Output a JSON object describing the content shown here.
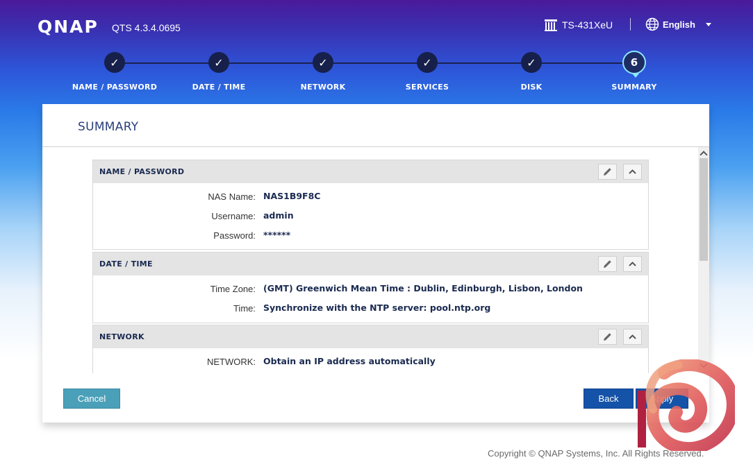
{
  "header": {
    "logo": "QNAP",
    "version": "QTS 4.3.4.0695",
    "model": "TS-431XeU",
    "language": "English"
  },
  "stepper": {
    "steps": [
      {
        "label": "NAME / PASSWORD",
        "state": "done"
      },
      {
        "label": "DATE / TIME",
        "state": "done"
      },
      {
        "label": "NETWORK",
        "state": "done"
      },
      {
        "label": "SERVICES",
        "state": "done"
      },
      {
        "label": "DISK",
        "state": "done"
      },
      {
        "label": "SUMMARY",
        "state": "current",
        "number": "6"
      }
    ],
    "check": "✓"
  },
  "card": {
    "title": "SUMMARY",
    "sections": [
      {
        "title": "NAME / PASSWORD",
        "rows": [
          {
            "key": "NAS Name:",
            "value": "NAS1B9F8C"
          },
          {
            "key": "Username:",
            "value": "admin"
          },
          {
            "key": "Password:",
            "value": "******"
          }
        ]
      },
      {
        "title": "DATE / TIME",
        "rows": [
          {
            "key": "Time Zone:",
            "value": "(GMT) Greenwich Mean Time : Dublin, Edinburgh, Lisbon, London"
          },
          {
            "key": "Time:",
            "value": "Synchronize with the NTP server: pool.ntp.org"
          }
        ]
      },
      {
        "title": "NETWORK",
        "rows": [
          {
            "key": "NETWORK:",
            "value": "Obtain an IP address automatically"
          }
        ]
      }
    ]
  },
  "buttons": {
    "cancel": "Cancel",
    "back": "Back",
    "apply": "Apply"
  },
  "footer": {
    "copyright": "Copyright © QNAP Systems, Inc. All Rights Reserved."
  },
  "colors": {
    "accent": "#1553a8",
    "cancel": "#4aa0b8",
    "step_dot": "#16204a",
    "current_ring": "#8ce8ff"
  }
}
